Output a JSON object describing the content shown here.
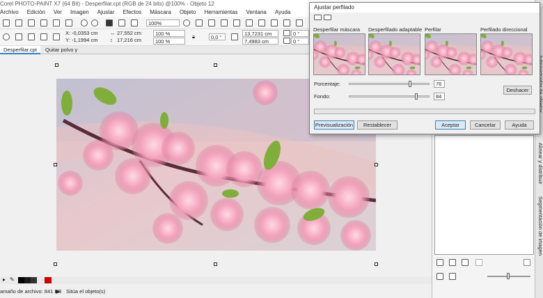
{
  "window": {
    "title": "Corel PHOTO-PAINT X7 (64 Bit) - Desperfilar.cpt (RGB de 24 bits) @100% - Objeto 12"
  },
  "menu": [
    "Archivo",
    "Edición",
    "Ver",
    "Imagen",
    "Ajustar",
    "Efectos",
    "Máscara",
    "Objeto",
    "Herramientas",
    "Ventana",
    "Ayuda"
  ],
  "toolbar": {
    "zoom": "100%",
    "x_label": "X:",
    "x_value": "-0,0353 cm",
    "y_label": "Y:",
    "y_value": "-1,1994 cm",
    "width_value": "27,552 cm",
    "height_value": "17,216 cm",
    "scale_w": "100 %",
    "scale_h": "100 %",
    "angle": "0,0 °",
    "pos_x2": "13,7231 cm",
    "pos_y2": "7,4983 cm",
    "skew_1": "0 °",
    "skew_2": "0 °"
  },
  "tabs": [
    "Desperfilar.cpt",
    "Quitar polvo y arañazos.cpt"
  ],
  "status": {
    "file_size": "amaño de archivo: 841 KB",
    "hint": "Sitúa el objeto(s)"
  },
  "palette_colors": [
    "#000000",
    "#1a1a1a",
    "#333333",
    "#d00000"
  ],
  "dialog": {
    "title": "Ajustar perfilado",
    "modes": [
      "Desperfilar máscara",
      "Desperfilado adaptable",
      "Perfilar",
      "Perfilado direccional"
    ],
    "porcentaje_label": "Porcentaje:",
    "porcentaje_value": "76",
    "porcentaje_fraction": 0.76,
    "fondo_label": "Fondo:",
    "fondo_value": "84",
    "fondo_fraction": 0.84,
    "deshacer": "Deshacer",
    "preview": "Previsualización",
    "reset": "Restablecer",
    "ok": "Aceptar",
    "cancel": "Cancelar",
    "help": "Ayuda"
  },
  "side_tabs": [
    "Administrador de objetos",
    "Alinear y distribuir",
    "Segmentación de imagen"
  ]
}
